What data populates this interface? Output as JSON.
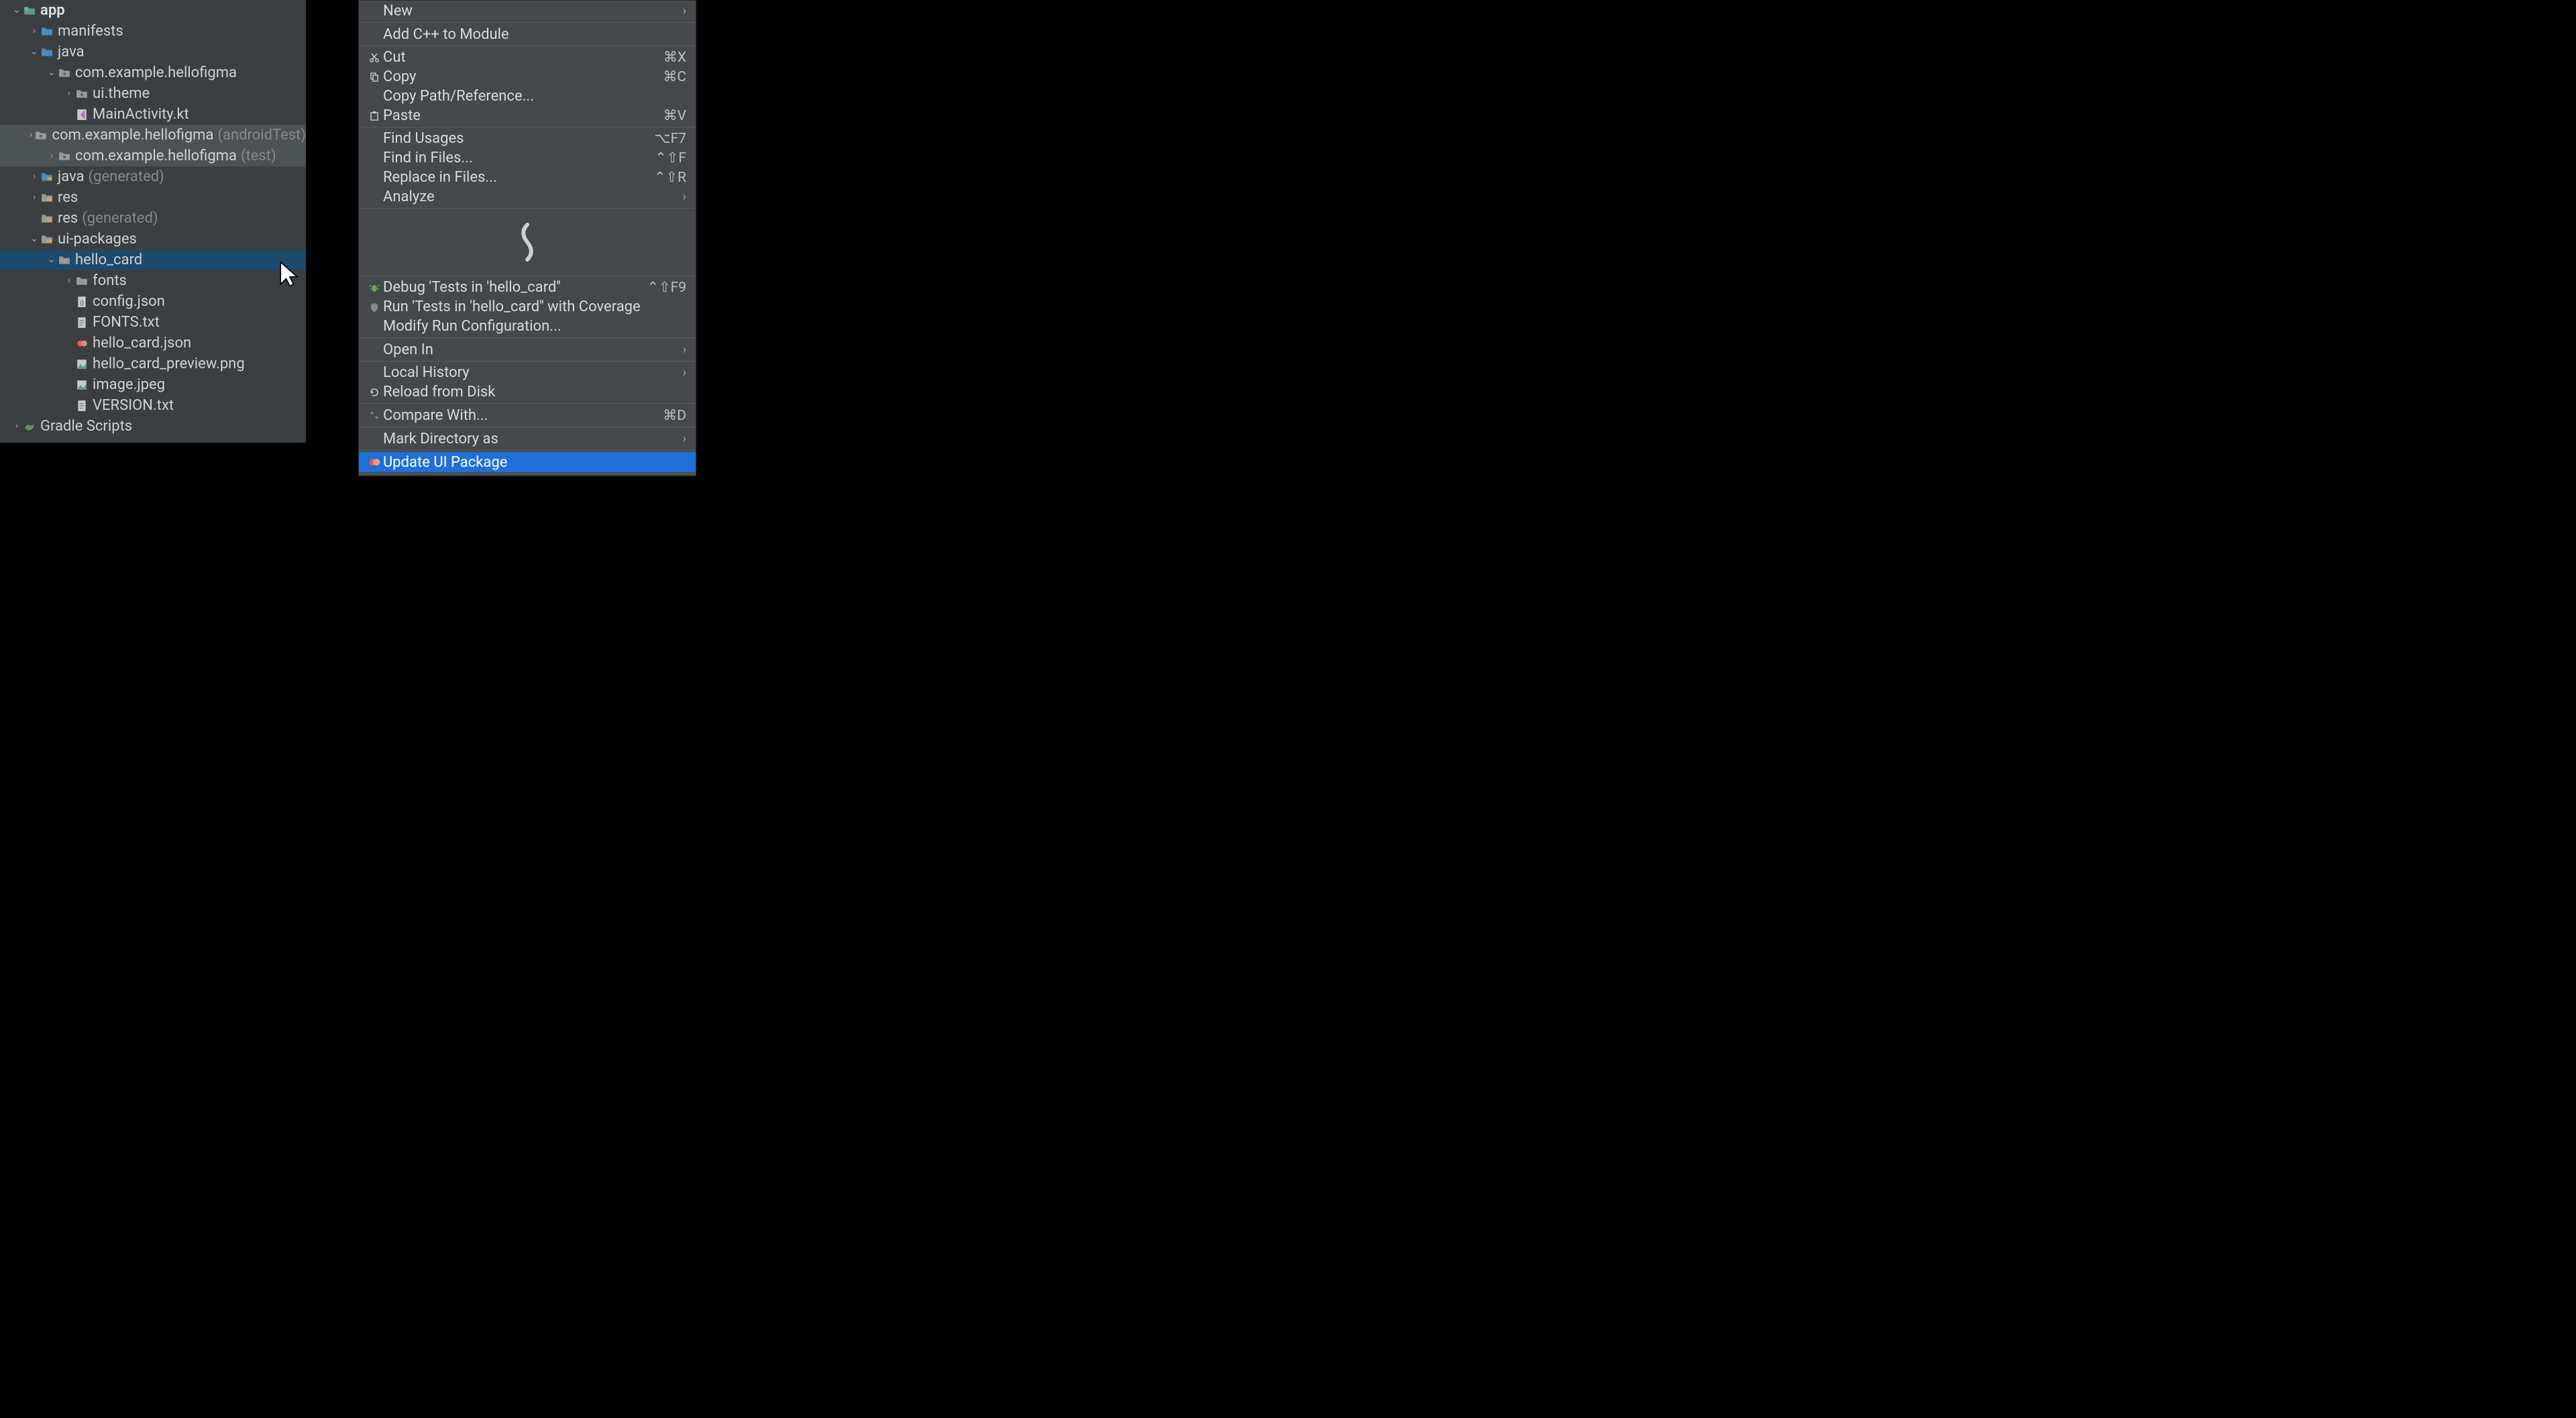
{
  "tree": {
    "app": "app",
    "manifests": "manifests",
    "java": "java",
    "pkg_main": "com.example.hellofigma",
    "ui_theme": "ui.theme",
    "main_activity": "MainActivity.kt",
    "pkg_androidtest": "com.example.hellofigma",
    "pkg_androidtest_suffix": "(androidTest)",
    "pkg_test": "com.example.hellofigma",
    "pkg_test_suffix": "(test)",
    "java_gen": "java",
    "java_gen_suffix": "(generated)",
    "res": "res",
    "res_gen": "res",
    "res_gen_suffix": "(generated)",
    "ui_packages": "ui-packages",
    "hello_card": "hello_card",
    "fonts": "fonts",
    "config_json": "config.json",
    "fonts_txt": "FONTS.txt",
    "hello_card_json": "hello_card.json",
    "hello_card_preview": "hello_card_preview.png",
    "image_jpeg": "image.jpeg",
    "version_txt": "VERSION.txt",
    "gradle_scripts": "Gradle Scripts"
  },
  "menu": {
    "new": "New",
    "add_cpp": "Add C++ to Module",
    "cut": "Cut",
    "cut_key": "⌘X",
    "copy": "Copy",
    "copy_key": "⌘C",
    "copy_path": "Copy Path/Reference...",
    "paste": "Paste",
    "paste_key": "⌘V",
    "find_usages": "Find Usages",
    "find_usages_key": "⌥F7",
    "find_files": "Find in Files...",
    "find_files_key": "⌃⇧F",
    "replace_files": "Replace in Files...",
    "replace_files_key": "⌃⇧R",
    "analyze": "Analyze",
    "debug": "Debug 'Tests in 'hello_card''",
    "debug_key": "⌃⇧F9",
    "run_coverage": "Run 'Tests in 'hello_card'' with Coverage",
    "modify_run": "Modify Run Configuration...",
    "open_in": "Open In",
    "local_history": "Local History",
    "reload_disk": "Reload from Disk",
    "compare_with": "Compare With...",
    "compare_with_key": "⌘D",
    "mark_dir": "Mark Directory as",
    "update_ui": "Update UI Package"
  }
}
